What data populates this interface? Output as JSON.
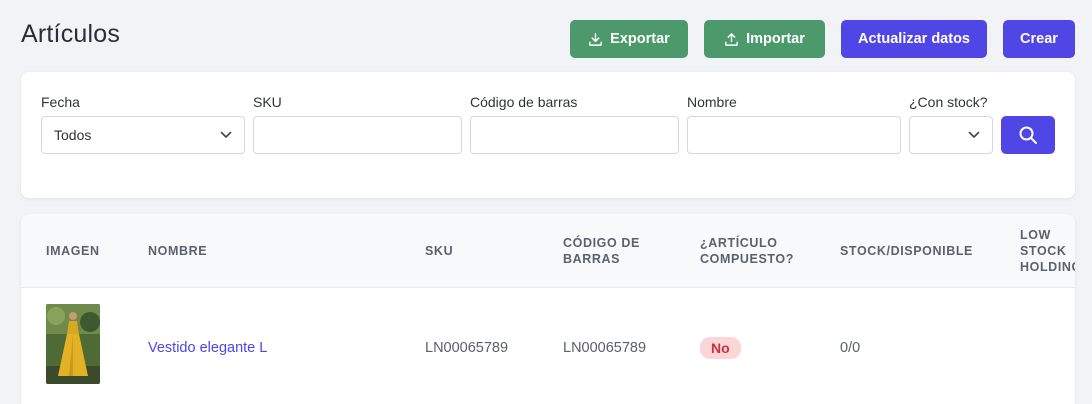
{
  "page": {
    "title": "Artículos"
  },
  "toolbar": {
    "export_label": "Exportar",
    "import_label": "Importar",
    "refresh_label": "Actualizar datos",
    "create_label": "Crear"
  },
  "filters": {
    "date": {
      "label": "Fecha",
      "value": "Todos"
    },
    "sku": {
      "label": "SKU",
      "value": ""
    },
    "barcode": {
      "label": "Código de barras",
      "value": ""
    },
    "name": {
      "label": "Nombre",
      "value": ""
    },
    "stock": {
      "label": "¿Con stock?",
      "value": ""
    }
  },
  "table": {
    "columns": [
      "IMAGEN",
      "NOMBRE",
      "SKU",
      "CÓDIGO DE BARRAS",
      "¿ARTÍCULO COMPUESTO?",
      "STOCK/DISPONIBLE",
      "LOW STOCK HOLDING"
    ],
    "rows": [
      {
        "name": "Vestido elegante L",
        "sku": "LN00065789",
        "barcode": "LN00065789",
        "composite": "No",
        "stock": "0/0"
      }
    ]
  },
  "colors": {
    "primary": "#4f46e5",
    "success": "#4c9a6c",
    "badge_bg": "#fcd5d6",
    "badge_text": "#c0363f"
  },
  "icons": [
    "download-icon",
    "upload-icon",
    "chevron-down-icon",
    "search-icon"
  ]
}
